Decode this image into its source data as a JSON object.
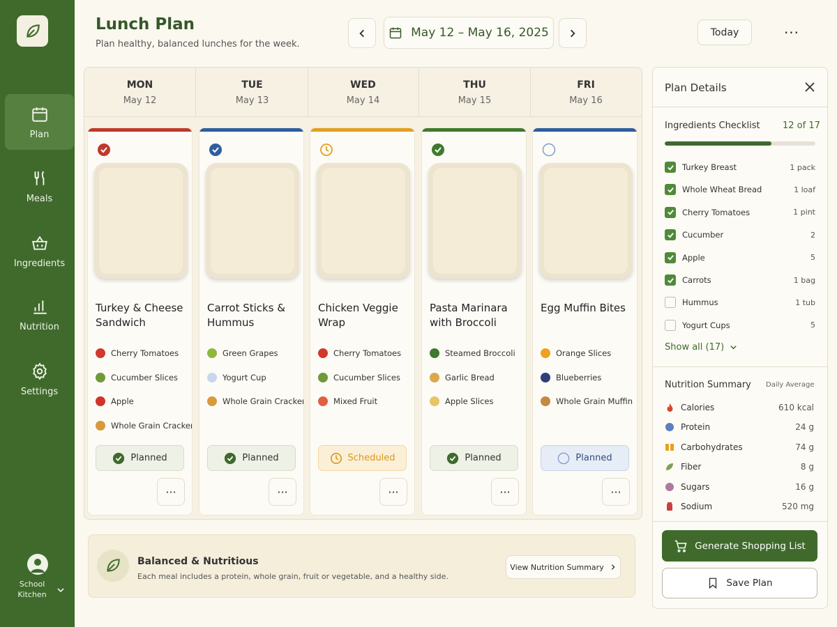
{
  "app": {
    "title": "Lunch Plan",
    "subtitle": "Plan healthy, balanced lunches for the week."
  },
  "toolbar": {
    "date_range": "May 12 – May 16, 2025",
    "today_label": "Today",
    "more_label": "···"
  },
  "sidebar": {
    "items": [
      {
        "label": "Plan",
        "icon": "calendar-icon"
      },
      {
        "label": "Meals",
        "icon": "utensils-icon"
      },
      {
        "label": "Ingredients",
        "icon": "basket-icon"
      },
      {
        "label": "Nutrition",
        "icon": "bar-chart-icon"
      },
      {
        "label": "Settings",
        "icon": "gear-icon"
      }
    ],
    "user": "School Kitchen"
  },
  "days": [
    {
      "name": "MON",
      "date": "May 12",
      "meal": "Turkey & Cheese Sandwich",
      "sides": [
        "Cherry Tomatoes",
        "Cucumber Slices",
        "Apple",
        "Whole Grain Crackers"
      ],
      "status": "Planned",
      "color": "#c0392b"
    },
    {
      "name": "TUE",
      "date": "May 13",
      "meal": "Carrot Sticks & Hummus",
      "sides": [
        "Green Grapes",
        "Yogurt Cup",
        "Whole Grain Crackers"
      ],
      "status": "Planned",
      "color": "#2f5d9e"
    },
    {
      "name": "WED",
      "date": "May 14",
      "meal": "Chicken Veggie Wrap",
      "sides": [
        "Cherry Tomatoes",
        "Cucumber Slices",
        "Mixed Fruit"
      ],
      "status": "Scheduled",
      "color": "#e0a020"
    },
    {
      "name": "THU",
      "date": "May 15",
      "meal": "Pasta Marinara with Broccoli",
      "sides": [
        "Steamed Broccoli",
        "Garlic Bread",
        "Apple Slices"
      ],
      "status": "Planned",
      "color": "#3f7a2c"
    },
    {
      "name": "FRI",
      "date": "May 16",
      "meal": "Egg Muffin Bites",
      "sides": [
        "Orange Slices",
        "Blueberries",
        "Whole Grain Muffin"
      ],
      "status": "Planned",
      "color": "#2f5d9e"
    }
  ],
  "tip": {
    "title": "Balanced & Nutritious",
    "text": "Each meal includes a protein, whole grain, fruit or vegetable, and a healthy side.",
    "button": "View Nutrition Summary"
  },
  "panel": {
    "title": "Plan Details",
    "checklist_title": "Ingredients Checklist",
    "checklist_count": "12 of 17",
    "progress": 0.71,
    "ingredients": [
      {
        "name": "Turkey Breast",
        "qty": "1 pack",
        "checked": true
      },
      {
        "name": "Whole Wheat Bread",
        "qty": "1 loaf",
        "checked": true
      },
      {
        "name": "Cherry Tomatoes",
        "qty": "1 pint",
        "checked": true
      },
      {
        "name": "Cucumber",
        "qty": "2",
        "checked": true
      },
      {
        "name": "Apple",
        "qty": "5",
        "checked": true
      },
      {
        "name": "Carrots",
        "qty": "1 bag",
        "checked": true
      },
      {
        "name": "Hummus",
        "qty": "1 tub",
        "checked": false
      },
      {
        "name": "Yogurt Cups",
        "qty": "5",
        "checked": false
      }
    ],
    "show_all": "Show all (17)",
    "nutrition_title": "Nutrition Summary",
    "nutrition_avg": "Daily Average",
    "nutrition": [
      {
        "name": "Calories",
        "value": "610 kcal"
      },
      {
        "name": "Protein",
        "value": "24 g"
      },
      {
        "name": "Carbohydrates",
        "value": "74 g"
      },
      {
        "name": "Fiber",
        "value": "8 g"
      },
      {
        "name": "Sugars",
        "value": "16 g"
      },
      {
        "name": "Sodium",
        "value": "520 mg"
      }
    ],
    "generate_label": "Generate Shopping List",
    "save_label": "Save Plan"
  }
}
